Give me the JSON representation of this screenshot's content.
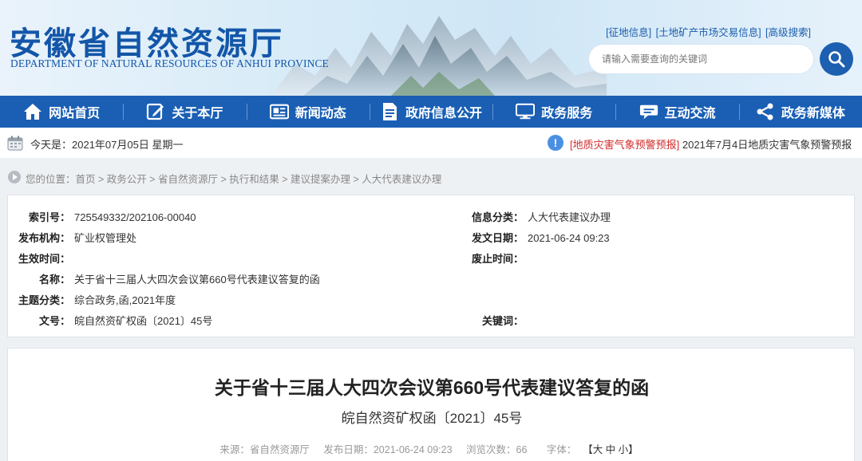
{
  "header": {
    "site_name_cn": "安徽省自然资源厅",
    "site_name_en": "DEPARTMENT OF NATURAL RESOURCES OF ANHUI PROVINCE",
    "top_links": [
      "[征地信息]",
      "[土地矿产市场交易信息]",
      "[高级搜索]"
    ],
    "search_placeholder": "请输入需要查询的关键词",
    "search_icon": "search-icon"
  },
  "nav": {
    "items": [
      {
        "label": "网站首页",
        "icon": "home-icon"
      },
      {
        "label": "关于本厅",
        "icon": "edit-icon"
      },
      {
        "label": "新闻动态",
        "icon": "news-icon"
      },
      {
        "label": "政府信息公开",
        "icon": "document-icon"
      },
      {
        "label": "政务服务",
        "icon": "monitor-icon"
      },
      {
        "label": "互动交流",
        "icon": "chat-icon"
      },
      {
        "label": "政务新媒体",
        "icon": "share-icon"
      }
    ]
  },
  "datebar": {
    "today": "今天是：2021年07月05日 星期一",
    "alert_tag": "[地质灾害气象预警预报]",
    "alert_text": "2021年7月4日地质灾害气象预警预报"
  },
  "breadcrumb": {
    "text": "您的位置：首页 > 政务公开 > 省自然资源厅 > 执行和结果 > 建议提案办理 > 人大代表建议办理"
  },
  "meta": {
    "index_no_label": "索引号：",
    "index_no": "725549332/202106-00040",
    "category_label": "信息分类：",
    "category": "人大代表建议办理",
    "publisher_label": "发布机构：",
    "publisher": "矿业权管理处",
    "publish_date_label": "发文日期：",
    "publish_date": "2021-06-24 09:23",
    "effective_label": "生效时间：",
    "effective": "",
    "expiry_label": "废止时间：",
    "expiry": "",
    "name_label": "名称：",
    "name": "关于省十三届人大四次会议第660号代表建议答复的函",
    "topic_label": "主题分类：",
    "topic": "综合政务,函,2021年度",
    "doc_no_label": "文号：",
    "doc_no": "皖自然资矿权函〔2021〕45号",
    "keywords_label": "关键词：",
    "keywords": ""
  },
  "article": {
    "title": "关于省十三届人大四次会议第660号代表建议答复的函",
    "subtitle": "皖自然资矿权函〔2021〕45号",
    "source": "来源：省自然资源厅",
    "date": "发布日期：2021-06-24 09:23",
    "views": "浏览次数：66",
    "font_label": "字体：",
    "font_sizes": "【大 中 小】"
  },
  "colors": {
    "nav_bg": "#1a5fb4",
    "brand_blue": "#1356a8",
    "alert_red": "#d12b2b"
  }
}
